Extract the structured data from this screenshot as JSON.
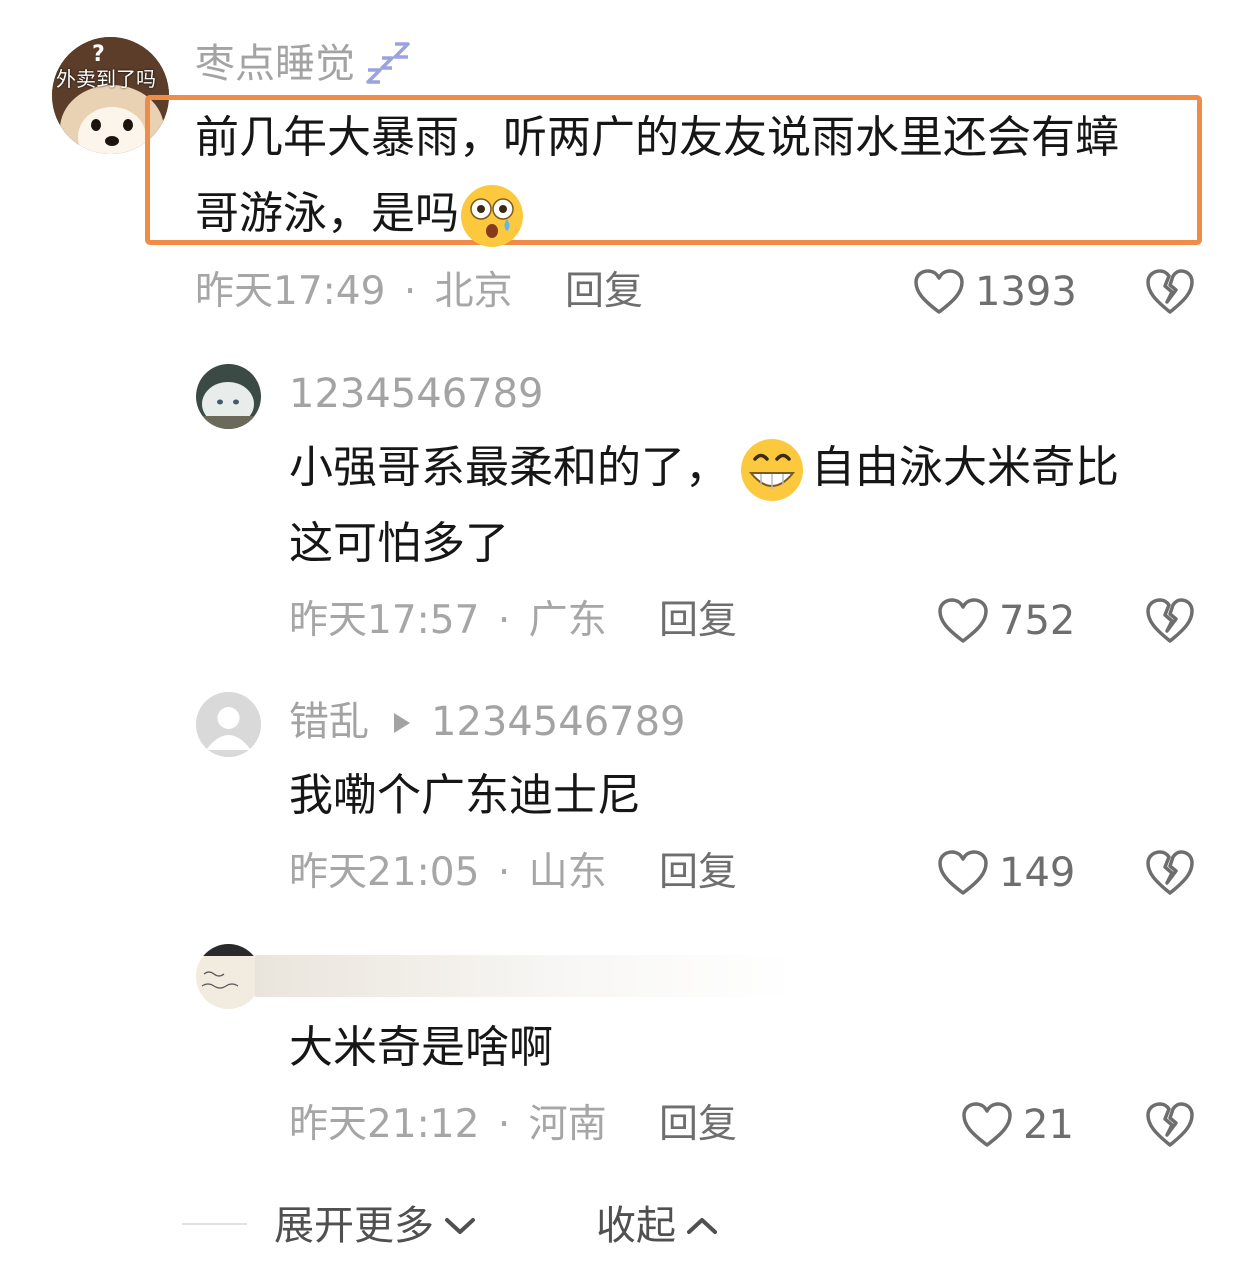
{
  "comments": [
    {
      "author": "枣点睡觉",
      "avatar_caption": "外卖到了吗",
      "avatar_mark": "?",
      "text_line1": "前几年大暴雨，听两广的友友说雨水里还会有蟑",
      "text_line2": "哥游泳，是吗",
      "time": "昨天17:49",
      "location": "北京",
      "reply_label": "回复",
      "likes": "1393",
      "highlighted": true
    },
    {
      "author": "1234546789",
      "text_line1_a": "小强哥系最柔和的了，",
      "text_line1_b": "自由泳大米奇比",
      "text_line2": "这可怕多了",
      "time": "昨天17:57",
      "location": "广东",
      "reply_label": "回复",
      "likes": "752"
    },
    {
      "author": "错乱",
      "reply_to": "1234546789",
      "text": "我嘞个广东迪士尼",
      "time": "昨天21:05",
      "location": "山东",
      "reply_label": "回复",
      "likes": "149"
    },
    {
      "author": "",
      "text": "大米奇是啥啊",
      "time": "昨天21:12",
      "location": "河南",
      "reply_label": "回复",
      "likes": "21"
    }
  ],
  "separator": "·",
  "footer": {
    "expand_label": "展开更多",
    "collapse_label": "收起"
  },
  "icons": {
    "like": "heart-outline-icon",
    "dislike": "broken-heart-icon",
    "sleep": "zzz-icon",
    "reply_arrow": "triangle-right-icon",
    "expand": "chevron-down-icon",
    "collapse": "chevron-up-icon"
  },
  "colors": {
    "highlight_border": "#ef8d48",
    "text_primary": "#161616",
    "text_secondary": "#a6a6a6",
    "zzz": "#9aa3e0"
  }
}
